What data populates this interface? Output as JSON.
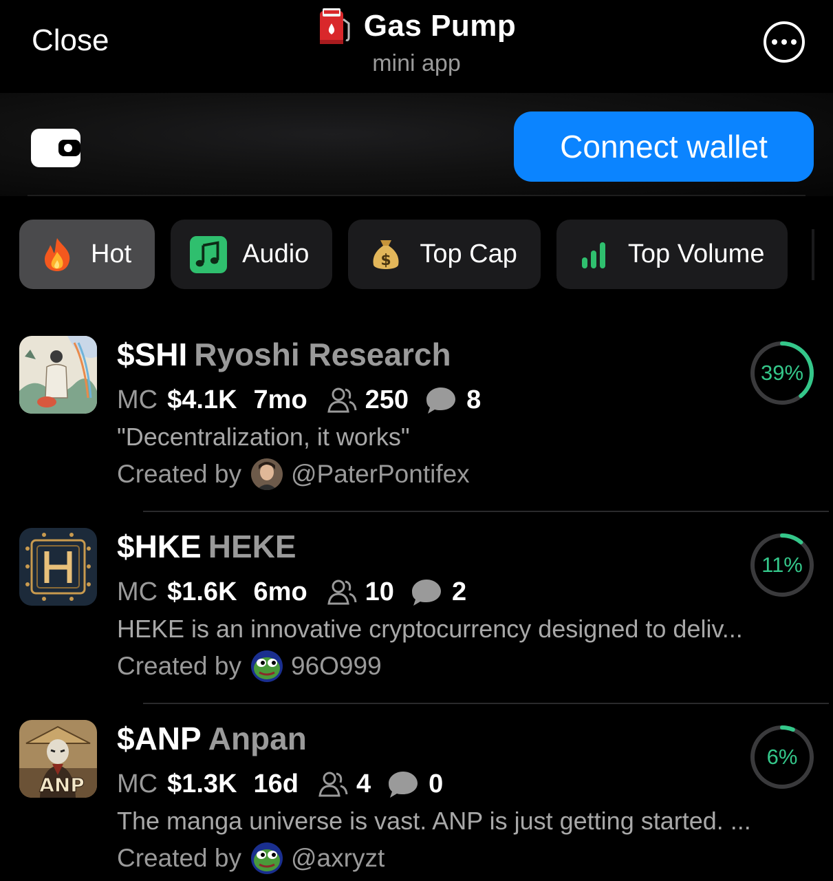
{
  "header": {
    "close_label": "Close",
    "title": "Gas Pump",
    "subtitle": "mini app"
  },
  "wallet": {
    "connect_label": "Connect wallet",
    "accent": "#0b84ff"
  },
  "tabs": [
    {
      "label": "Hot",
      "icon": "fire-icon",
      "active": true
    },
    {
      "label": "Audio",
      "icon": "music-note-icon",
      "active": false
    },
    {
      "label": "Top Cap",
      "icon": "money-bag-icon",
      "active": false
    },
    {
      "label": "Top Volume",
      "icon": "bar-chart-icon",
      "active": false
    }
  ],
  "tokens": [
    {
      "ticker": "$SHI",
      "name": "Ryoshi Research",
      "mc_label": "MC",
      "mc": "$4.1K",
      "age": "7mo",
      "holders": "250",
      "comments": "8",
      "description": "\"Decentralization, it works\"",
      "created_by_label": "Created by",
      "creator": "@PaterPontifex",
      "progress_percent": 39,
      "progress_label": "39%"
    },
    {
      "ticker": "$HKE",
      "name": "HEKE",
      "mc_label": "MC",
      "mc": "$1.6K",
      "age": "6mo",
      "holders": "10",
      "comments": "2",
      "description": "HEKE is an innovative cryptocurrency designed to deliv...",
      "created_by_label": "Created by",
      "creator": "96O999",
      "progress_percent": 11,
      "progress_label": "11%"
    },
    {
      "ticker": "$ANP",
      "name": "Anpan",
      "mc_label": "MC",
      "mc": "$1.3K",
      "age": "16d",
      "holders": "4",
      "comments": "0",
      "description": "The manga universe is vast. ANP is just getting started. ...",
      "created_by_label": "Created by",
      "creator": "@axryzt",
      "progress_percent": 6,
      "progress_label": "6%",
      "thumb_text": "ANP"
    }
  ],
  "colors": {
    "progress": "#34c78a",
    "progress_track": "#3a3a3c"
  }
}
